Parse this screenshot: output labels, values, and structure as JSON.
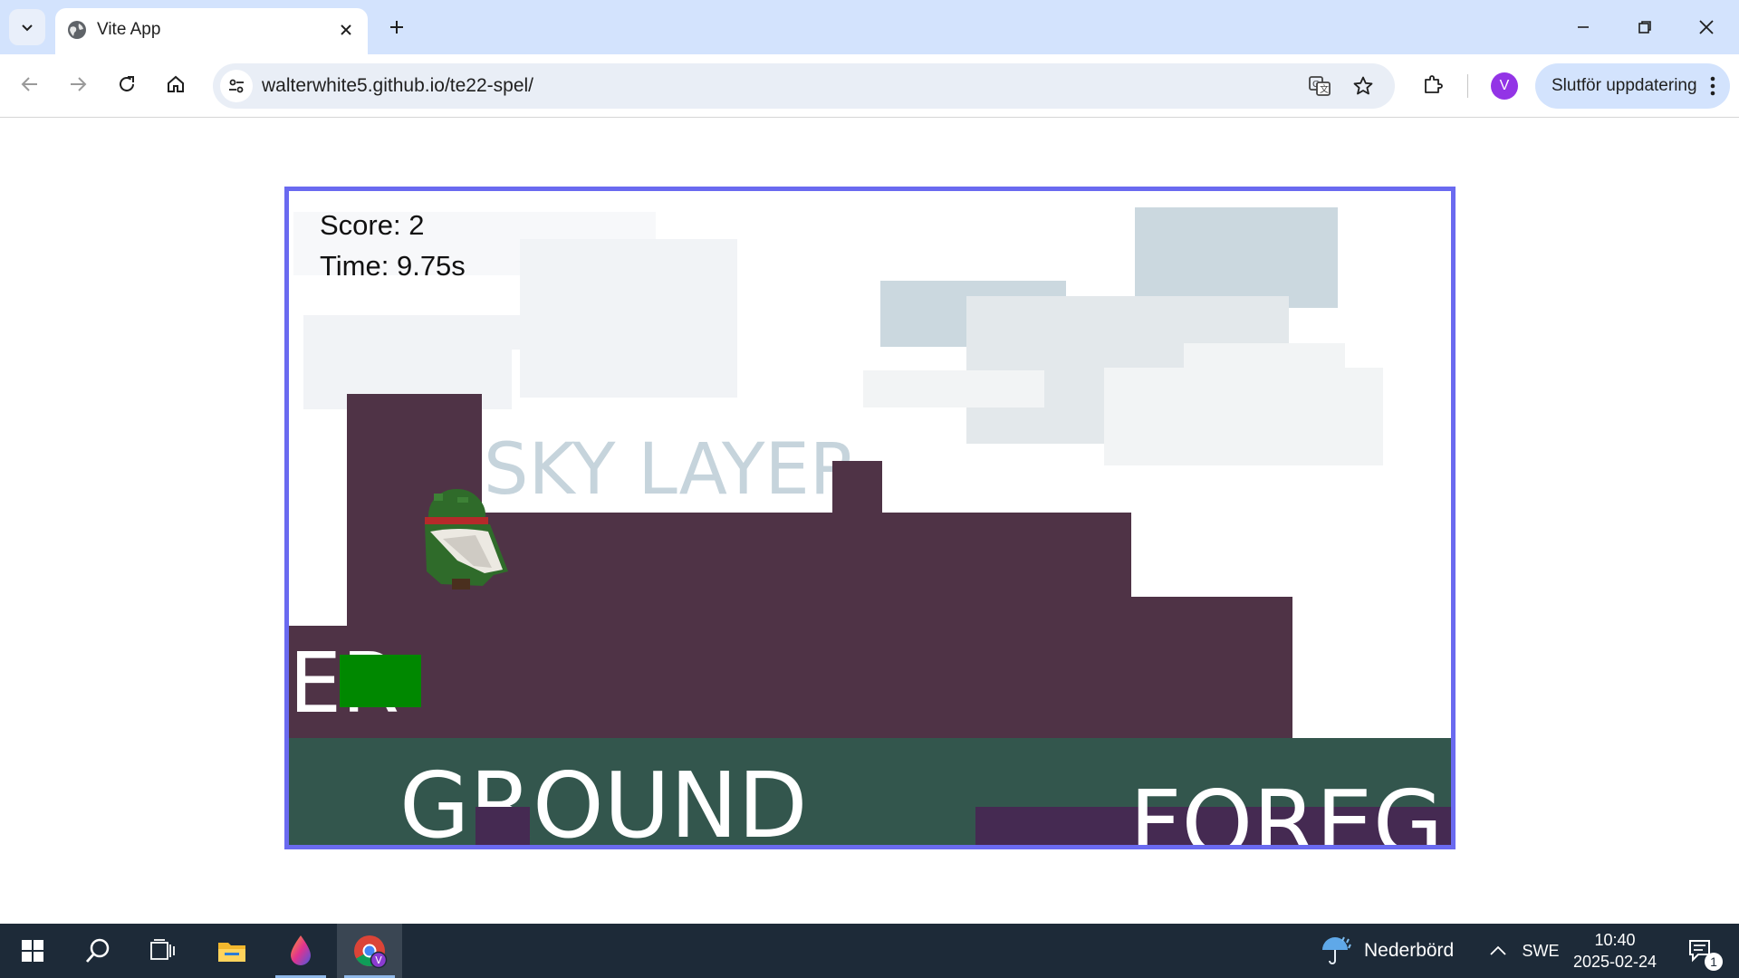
{
  "browser": {
    "tab": {
      "title": "Vite App",
      "favicon": "globe-icon"
    },
    "address": {
      "url": "walterwhite5.github.io/te22-spel/"
    },
    "profile": {
      "initial": "V",
      "color": "#9334e6"
    },
    "update_button": {
      "label": "Slutför uppdatering"
    }
  },
  "game": {
    "hud": {
      "score": "Score: 2",
      "time": "Time: 9.75s"
    },
    "layers": {
      "sky": "SKY LAYER",
      "ground": "GROUND",
      "foreground": "FOREGROUND",
      "fragment": "ER"
    },
    "colors": {
      "border": "#6a6af0",
      "terrain": "#4f3346",
      "ground": "#33564d",
      "purple_block": "#452a52",
      "player_block": "#008800"
    }
  },
  "taskbar": {
    "weather": {
      "label": "Nederbörd",
      "icon": "umbrella-rain-icon"
    },
    "language": "SWE",
    "clock": {
      "time": "10:40",
      "date": "2025-02-24"
    },
    "notifications": {
      "count": "1"
    }
  }
}
